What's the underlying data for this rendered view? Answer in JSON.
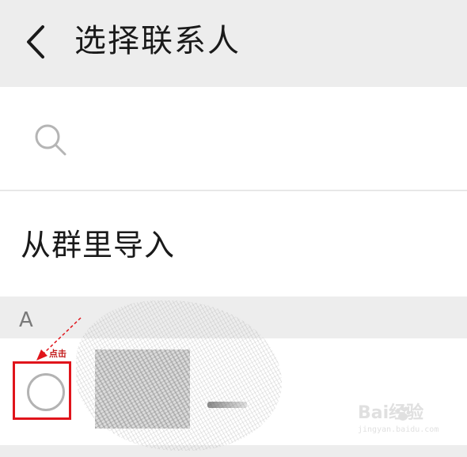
{
  "header": {
    "title": "选择联系人",
    "back_icon": "chevron-left-icon"
  },
  "search": {
    "placeholder": "",
    "value": "",
    "icon": "search-icon"
  },
  "import_from_group": {
    "label": "从群里导入"
  },
  "contacts": {
    "section_letter": "A"
  },
  "annotation": {
    "note": "点击",
    "box_color": "#e0141b"
  },
  "watermark": {
    "brand": "Bai经验",
    "url": "jingyan.baidu.com"
  },
  "colors": {
    "header_bg": "#ededed",
    "row_bg": "#ffffff",
    "radio_border": "#b3b3b3",
    "annotation_red": "#e0141b"
  }
}
